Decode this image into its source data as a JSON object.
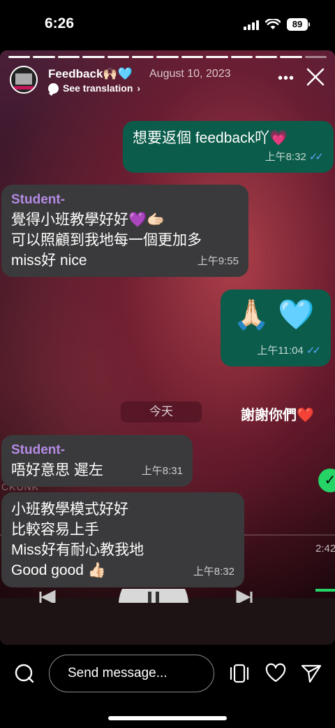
{
  "status_bar": {
    "time": "6:26",
    "battery": "89"
  },
  "story": {
    "progress_segments": 13,
    "progress_filled": 12,
    "author": "Feedback🙌🏻🩵",
    "date": "August 10, 2023",
    "translation_label": "See translation",
    "translation_chevron": "›"
  },
  "chat": {
    "messages": [
      {
        "text": "想要返個 feedback吖💗",
        "time": "上午8:32",
        "read": "✓✓"
      },
      {
        "sender": "Student-",
        "lines": [
          "覺得小班教學好好💜🫱🏻",
          "可以照顧到我地每一個更加多",
          "miss好 nice"
        ],
        "time": "上午9:55"
      },
      {
        "text": "🙏🏻 🩵",
        "time": "上午11:04",
        "read": "✓✓"
      },
      {
        "sender": "Student-",
        "text": "唔好意思 遲左",
        "time": "上午8:31"
      },
      {
        "lines": [
          "小班教學模式好好",
          "比較容易上手",
          "Miss好有耐心教我地",
          "Good good 👍🏻"
        ],
        "time": "上午8:32"
      }
    ],
    "today_label": "今天",
    "overlay_text": "謝謝你們❤️",
    "background_text": "CKUNK",
    "background_timer": "2:42"
  },
  "bottom_bar": {
    "message_placeholder": "Send message..."
  },
  "colors": {
    "outgoing_bubble": "#0b5c4a",
    "incoming_bubble": "#3a3a3c",
    "sender_name": "#b58ae3",
    "read_ticks": "#5aa9ff"
  }
}
